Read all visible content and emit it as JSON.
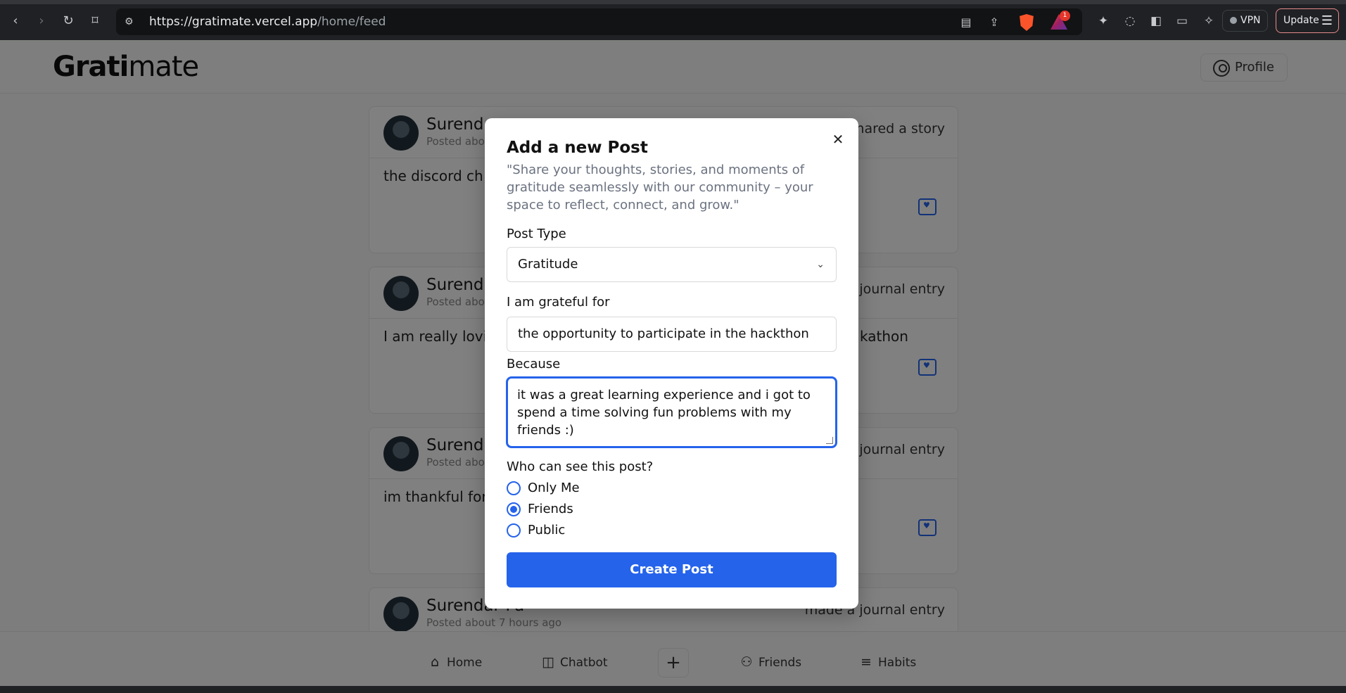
{
  "browser": {
    "url_host": "https://gratimate.vercel.app",
    "url_path": "/home/feed",
    "rewards_badge": "1",
    "vpn_label": "VPN",
    "update_label": "Update"
  },
  "app": {
    "logo_bold": "Grati",
    "logo_rest": "mate",
    "profile_label": "Profile"
  },
  "feed": [
    {
      "name": "Surend",
      "time": "Posted abo",
      "action": "shared a story",
      "body": "the discord ch"
    },
    {
      "name": "Surend",
      "time": "Posted abo",
      "action": "a journal entry",
      "body": "I am really lovi",
      "body_tail": "kathon"
    },
    {
      "name": "Surend",
      "time": "Posted abo",
      "action": "a journal entry",
      "body": "im thankful for"
    },
    {
      "name": "Surendar Pa",
      "time": "Posted about 7 hours ago",
      "action": "made a journal entry"
    }
  ],
  "bottom_nav": {
    "home": "Home",
    "chatbot": "Chatbot",
    "plus": "+",
    "friends": "Friends",
    "habits": "Habits"
  },
  "modal": {
    "title": "Add a new Post",
    "description": "\"Share your thoughts, stories, and moments of gratitude seamlessly with our community – your space to reflect, connect, and grow.\"",
    "post_type_label": "Post Type",
    "post_type_value": "Gratitude",
    "grateful_label": "I am grateful for",
    "grateful_value": "the opportunity to participate in the hackthon",
    "because_label": "Because",
    "because_value": "it was a great learning experience and i got to spend a time solving fun problems with my friends :)",
    "visibility_label": "Who can see this post?",
    "visibility_options": [
      "Only Me",
      "Friends",
      "Public"
    ],
    "visibility_selected": "Friends",
    "submit_label": "Create Post"
  }
}
